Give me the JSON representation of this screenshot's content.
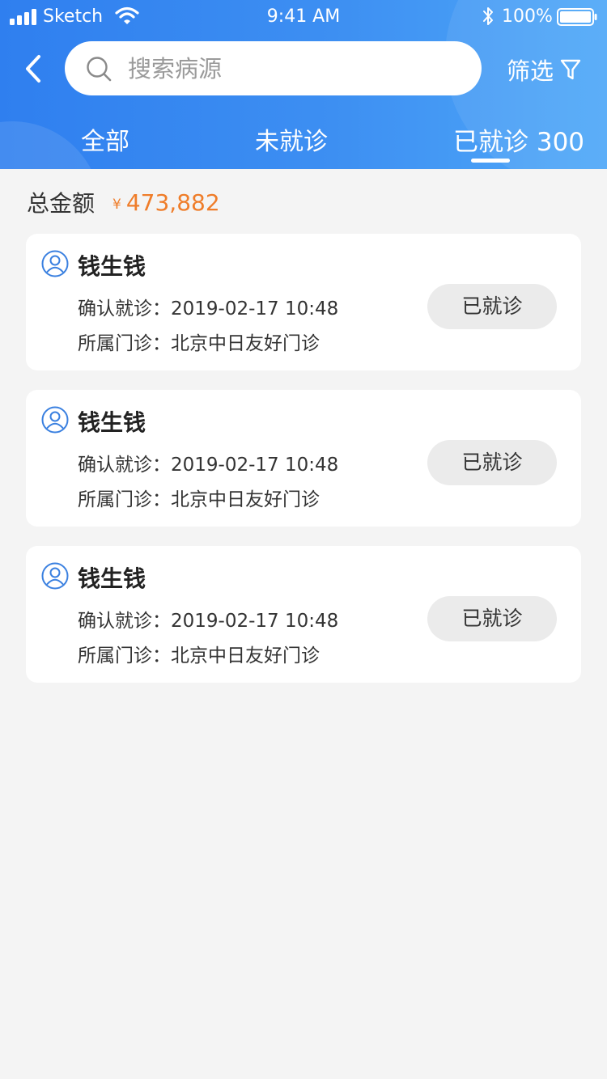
{
  "status_bar": {
    "carrier": "Sketch",
    "time": "9:41 AM",
    "battery": "100%"
  },
  "header": {
    "search_placeholder": "搜索病源",
    "filter_label": "筛选",
    "colors": {
      "gradient_start": "#2f7fef",
      "gradient_end": "#4fa8f8"
    }
  },
  "tabs": [
    {
      "label": "全部",
      "active": false
    },
    {
      "label": "未就诊",
      "active": false
    },
    {
      "label": "已就诊 300",
      "active": true
    }
  ],
  "summary": {
    "label": "总金额",
    "currency": "¥",
    "amount": "473,882",
    "amount_color": "#ef7d2a"
  },
  "records": [
    {
      "name": "钱生钱",
      "confirm": "确认就诊：2019-02-17 10:48",
      "clinic": "所属门诊：北京中日友好门诊",
      "status": "已就诊"
    },
    {
      "name": "钱生钱",
      "confirm": "确认就诊：2019-02-17 10:48",
      "clinic": "所属门诊：北京中日友好门诊",
      "status": "已就诊"
    },
    {
      "name": "钱生钱",
      "confirm": "确认就诊：2019-02-17 10:48",
      "clinic": "所属门诊：北京中日友好门诊",
      "status": "已就诊"
    }
  ],
  "icons": {
    "back": "chevron-left-icon",
    "search": "search-icon",
    "filter": "funnel-icon",
    "avatar": "user-circle-icon"
  }
}
